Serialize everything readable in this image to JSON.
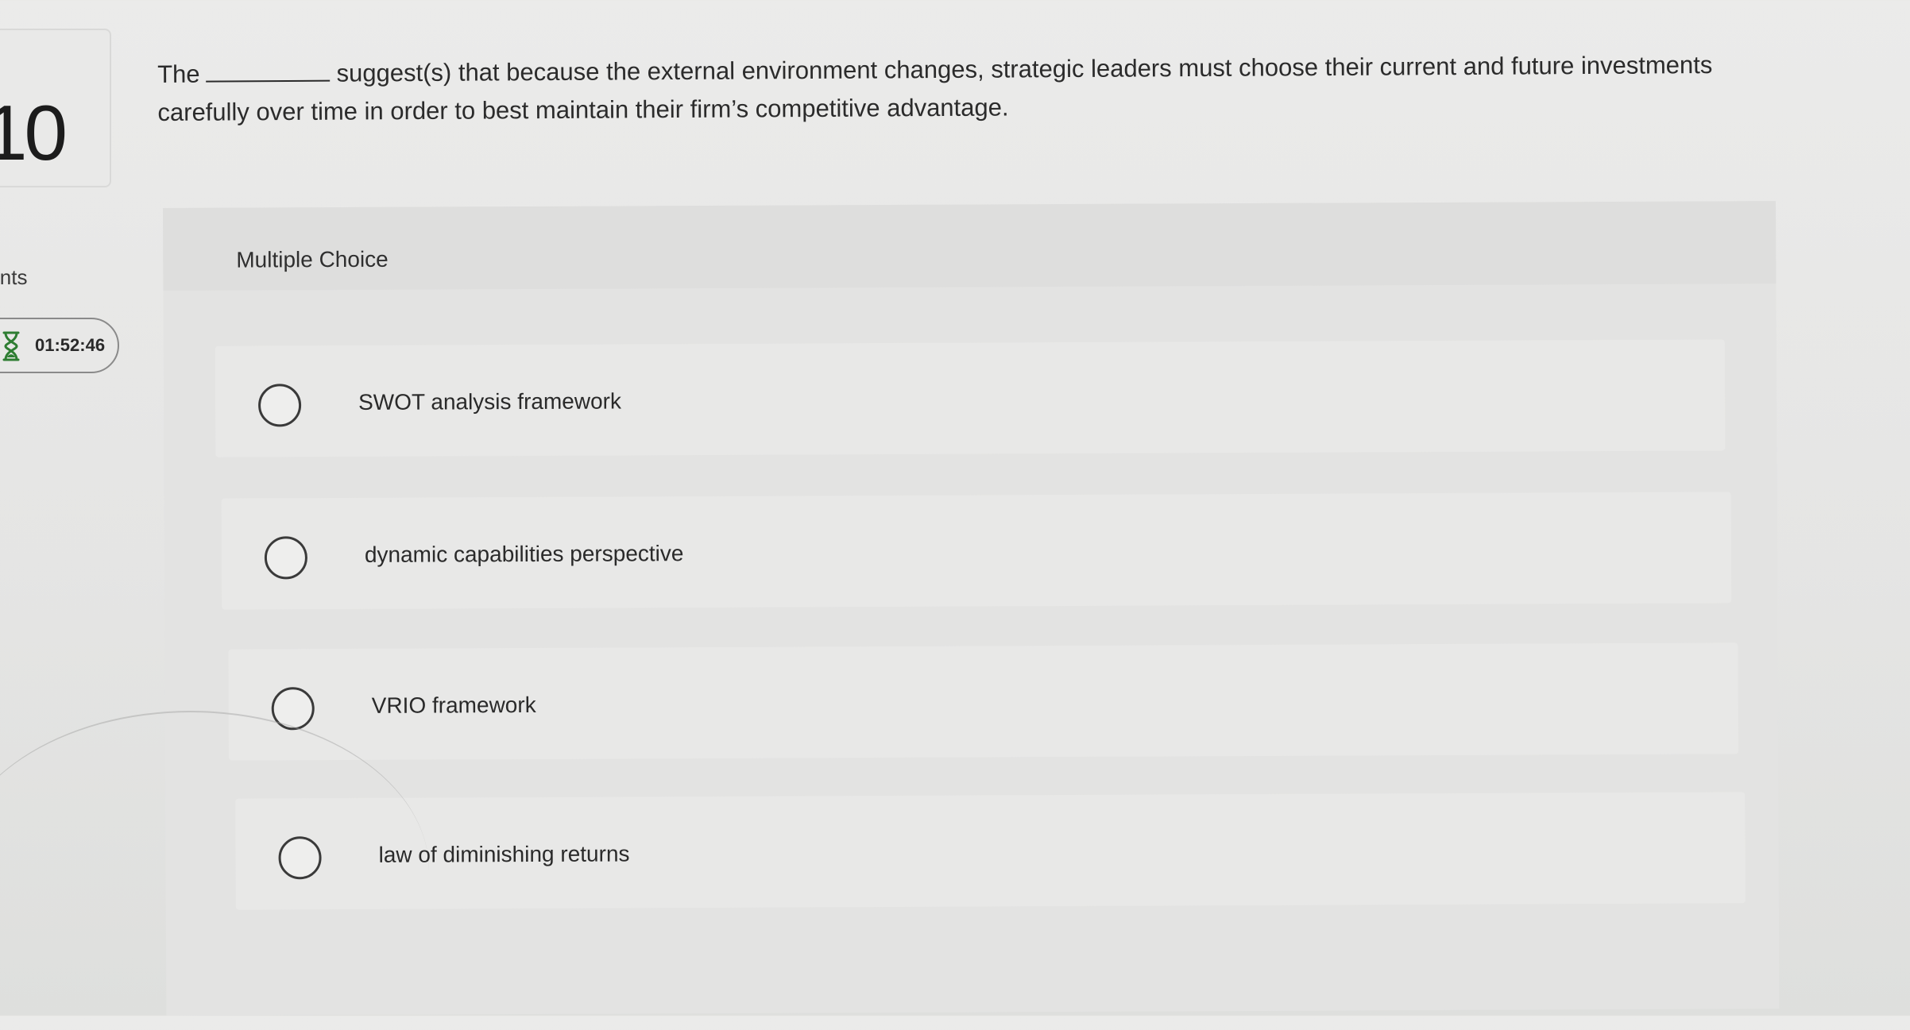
{
  "question": {
    "number": "10",
    "points_label": "ints",
    "timer": "01:52:46",
    "text_before_blank": "The",
    "text_after_blank": "suggest(s) that because the external environment changes, strategic leaders must choose their current and future investments carefully over time in order to best maintain their firm’s competitive advantage."
  },
  "answer_section": {
    "type_label": "Multiple Choice",
    "options": [
      {
        "label": "SWOT analysis framework",
        "selected": false
      },
      {
        "label": "dynamic capabilities perspective",
        "selected": false
      },
      {
        "label": "VRIO framework",
        "selected": false
      },
      {
        "label": "law of diminishing returns",
        "selected": false
      }
    ]
  },
  "icons": {
    "timer": "hourglass-icon",
    "option_marker": "radio-button-icon"
  },
  "colors": {
    "background": "#e7e7e6",
    "panel": "#e3e3e2",
    "text": "#2b2b2b"
  }
}
